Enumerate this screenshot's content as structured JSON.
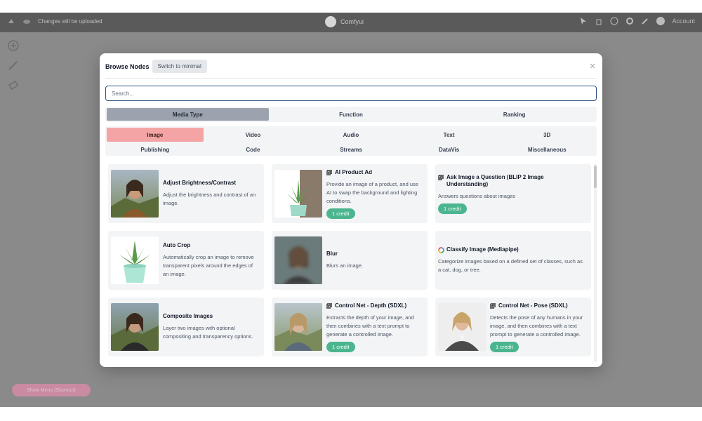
{
  "app": {
    "status_text": "Changes will be uploaded",
    "center_label": "Comfyui",
    "user_label": "Account",
    "bottom_button": "Show Menu (Shortcut)"
  },
  "modal": {
    "title": "Browse Nodes",
    "switch_label": "Switch to minimal",
    "search_placeholder": "Search..."
  },
  "tabs": [
    {
      "label": "Media Type",
      "active": true
    },
    {
      "label": "Function",
      "active": false
    },
    {
      "label": "Ranking",
      "active": false
    }
  ],
  "categories": [
    {
      "label": "Image",
      "active": true
    },
    {
      "label": "Video"
    },
    {
      "label": "Audio"
    },
    {
      "label": "Text"
    },
    {
      "label": "3D"
    },
    {
      "label": "Publishing"
    },
    {
      "label": "Code"
    },
    {
      "label": "Streams"
    },
    {
      "label": "DataVis"
    },
    {
      "label": "Miscellaneous"
    }
  ],
  "cards": [
    {
      "title": "Adjust Brightness/Contrast",
      "desc": "Adjust the brightness and contrast of an image.",
      "thumb": "portrait-woman",
      "credit": ""
    },
    {
      "title": "AI Product Ad",
      "desc": "Provide an image of a product, and use AI to swap the background and lighting conditions.",
      "thumb": "plant-pot",
      "icon": "api-icon",
      "credit": "1 credit"
    },
    {
      "title": "Ask Image a Question (BLIP 2 Image Understanding)",
      "desc": "Answers questions about images",
      "thumb": "",
      "icon": "api-icon",
      "credit": "1 credit"
    },
    {
      "title": "Auto Crop",
      "desc": "Automatically crop an image to remove transparent pixels around the edges of an image.",
      "thumb": "plant-pot",
      "credit": ""
    },
    {
      "title": "Blur",
      "desc": "Blurs an image.",
      "thumb": "blurred-portrait",
      "credit": ""
    },
    {
      "title": "Classify Image (Mediapipe)",
      "desc": "Categorize images based on a defined set of classes, such as a cat, dog, or tree.",
      "thumb": "",
      "icon": "google-icon",
      "credit": ""
    },
    {
      "title": "Composite Images",
      "desc": "Layer two images with optional compositing and transparency options.",
      "thumb": "portrait-woman",
      "credit": ""
    },
    {
      "title": "Control Net - Depth (SDXL)",
      "desc": "Extracts the depth of your image, and then combines with a text prompt to generate a controlled image.",
      "thumb": "portrait-woman-light",
      "icon": "api-icon",
      "credit": "1 credit"
    },
    {
      "title": "Control Net - Pose (SDXL)",
      "desc": "Detects the pose of any humans in your image, and then combines with a text prompt to generate a controlled image.",
      "thumb": "business-woman",
      "icon": "api-icon",
      "credit": "1 credit"
    }
  ]
}
